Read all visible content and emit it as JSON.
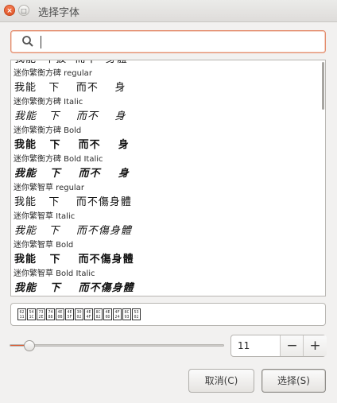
{
  "window": {
    "title": "选择字体",
    "close_glyph": "×",
    "max_glyph": "□"
  },
  "search": {
    "value": "",
    "placeholder": ""
  },
  "top_partial_preview": "我能  下披  而不  身體",
  "fonts": [
    {
      "name": "迷你繁衡方碑 regular",
      "preview": "我能   下    而不    身",
      "style": "regular"
    },
    {
      "name": "迷你繁衡方碑 Italic",
      "preview": "我能   下    而不    身",
      "style": "italic"
    },
    {
      "name": "迷你繁衡方碑 Bold",
      "preview": "我能   下    而不    身",
      "style": "bold"
    },
    {
      "name": "迷你繁衡方碑 Bold Italic",
      "preview": "我能   下    而不    身",
      "style": "bold italic"
    },
    {
      "name": "迷你繁智草 regular",
      "preview": "我能   下    而不傷身體",
      "style": "regular"
    },
    {
      "name": "迷你繁智草 Italic",
      "preview": "我能   下    而不傷身體",
      "style": "italic"
    },
    {
      "name": "迷你繁智草 Bold",
      "preview": "我能   下    而不傷身體",
      "style": "bold"
    },
    {
      "name": "迷你繁智草 Bold Italic",
      "preview": "我能   下    而不傷身體",
      "style": "bold italic"
    }
  ],
  "preview_tofu": [
    "62 11",
    "54 1C",
    "73 2E",
    "74 88",
    "4E 0B",
    "4E 5F",
    "30 02",
    "4E 4F",
    "8C 82",
    "4E 0D",
    "4F 24",
    "8C 93",
    "53 02"
  ],
  "size": {
    "value": "11",
    "minus": "−",
    "plus": "+",
    "slider_fraction": 0.09
  },
  "buttons": {
    "cancel": "取消(C)",
    "select": "选择(S)"
  },
  "colors": {
    "accent": "#e0572a",
    "focus_border": "#e48a6a"
  }
}
